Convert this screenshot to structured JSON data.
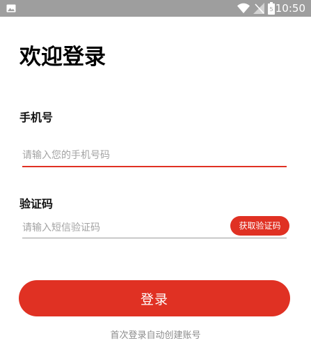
{
  "status_bar": {
    "time": "10:50",
    "battery_level": "5",
    "icons": [
      "gallery-icon",
      "wifi-icon",
      "signal-icon",
      "battery-icon"
    ]
  },
  "login": {
    "title": "欢迎登录",
    "phone_label": "手机号",
    "phone_placeholder": "请输入您的手机号码",
    "phone_value": "",
    "code_label": "验证码",
    "code_placeholder": "请输入短信验证码",
    "code_value": "",
    "get_code_button": "获取验证码",
    "submit_button": "登录",
    "hint": "首次登录自动创建账号"
  },
  "colors": {
    "accent": "#e03123",
    "status_bar": "#9e9e9e",
    "placeholder": "#a3a3a3",
    "hint": "#8c8c8c"
  }
}
